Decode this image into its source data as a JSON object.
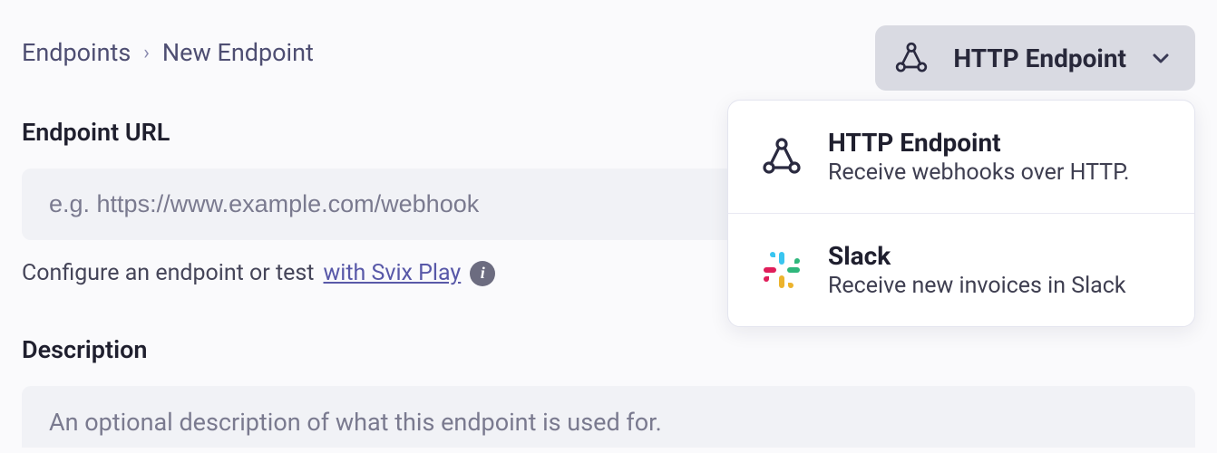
{
  "breadcrumb": {
    "root": "Endpoints",
    "current": "New Endpoint"
  },
  "url_section": {
    "label": "Endpoint URL",
    "placeholder": "e.g. https://www.example.com/webhook",
    "hint_prefix": "Configure an endpoint or test ",
    "hint_link": "with Svix Play"
  },
  "description_section": {
    "label": "Description",
    "placeholder": "An optional description of what this endpoint is used for."
  },
  "connector_button": {
    "label": "HTTP Endpoint"
  },
  "dropdown": {
    "items": [
      {
        "title": "HTTP Endpoint",
        "desc": "Receive webhooks over HTTP.",
        "icon": "webhook"
      },
      {
        "title": "Slack",
        "desc": "Receive new invoices in Slack",
        "icon": "slack"
      }
    ]
  }
}
